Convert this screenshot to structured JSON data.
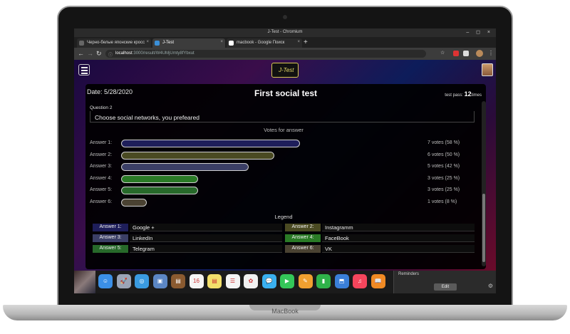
{
  "window": {
    "title": "J-Test - Chromium",
    "controls": "– ◻ ×"
  },
  "tabs": [
    {
      "label": "Черно-белые японские кросс",
      "active": false,
      "favicon_color": "#666666"
    },
    {
      "label": "J-Test",
      "active": true,
      "favicon_color": "#3a8fd8"
    },
    {
      "label": "macbook - Google Поиск",
      "active": false,
      "favicon_color": "#ffffff"
    }
  ],
  "new_tab": "+",
  "address": {
    "host": "localhost",
    "path": ":3000/result/W4UMjUmty8fYbxut",
    "lock": "ⓘ",
    "back": "←",
    "forward": "→",
    "reload": "↻"
  },
  "header": {
    "logo": "J-Test"
  },
  "result": {
    "date": "Date: 5/28/2020",
    "title": "First social test",
    "test_pass_label": "test pass:",
    "test_pass_count": "12",
    "test_pass_unit": "times",
    "question_number": "Question 2",
    "question_text": "Choose social networks, you prefeared",
    "chart_title": "Votes for answer",
    "legend_title": "Legend"
  },
  "chart_data": {
    "type": "bar",
    "orientation": "horizontal",
    "title": "Votes for answer",
    "categories": [
      "Answer 1:",
      "Answer 2:",
      "Answer 3:",
      "Answer 4:",
      "Answer 5:",
      "Answer 6:"
    ],
    "values": [
      7,
      6,
      5,
      3,
      3,
      1
    ],
    "labels": [
      "7 votes (58 %)",
      "6 votes (50 %)",
      "5 votes (42 %)",
      "3 votes (25 %)",
      "3 votes (25 %)",
      "1 votes (8 %)"
    ],
    "colors": [
      "#1e1e5a",
      "#4a4a22",
      "#3b3f66",
      "#2a7a26",
      "#27692a",
      "#4a4232"
    ],
    "max": 12
  },
  "legend": [
    {
      "chip": "Answer 1:",
      "name": "Google +",
      "color": "#1e1e5a"
    },
    {
      "chip": "Answer 2:",
      "name": "Instagramm",
      "color": "#4a4a22"
    },
    {
      "chip": "Answer 3:",
      "name": "LinkedIn",
      "color": "#3b3f66"
    },
    {
      "chip": "Answer 4:",
      "name": "FaceBook",
      "color": "#2a7a26"
    },
    {
      "chip": "Answer 5:",
      "name": "Telegram",
      "color": "#27692a"
    },
    {
      "chip": "Answer 6:",
      "name": "VK",
      "color": "#4a4232"
    }
  ],
  "dock": {
    "icons": [
      {
        "name": "finder-icon",
        "color": "#3b8fe6",
        "glyph": "☺"
      },
      {
        "name": "launchpad-icon",
        "color": "#9aa4b6",
        "glyph": "🚀"
      },
      {
        "name": "safari-icon",
        "color": "#3a9be0",
        "glyph": "◎"
      },
      {
        "name": "preview-icon",
        "color": "#5b86c4",
        "glyph": "▣"
      },
      {
        "name": "notes-brown-icon",
        "color": "#8a5a30",
        "glyph": "▤"
      },
      {
        "name": "calendar-icon",
        "color": "#f4f4f4",
        "glyph": "16"
      },
      {
        "name": "stickies-icon",
        "color": "#f2df6b",
        "glyph": "▤"
      },
      {
        "name": "reminders-icon",
        "color": "#f4f4f4",
        "glyph": "☰"
      },
      {
        "name": "photos-icon",
        "color": "#f0f0f0",
        "glyph": "✿"
      },
      {
        "name": "messages-icon",
        "color": "#3ab0f0",
        "glyph": "💬"
      },
      {
        "name": "facetime-icon",
        "color": "#34c759",
        "glyph": "▶"
      },
      {
        "name": "pages-icon",
        "color": "#f0a030",
        "glyph": "✎"
      },
      {
        "name": "numbers-icon",
        "color": "#2fb34a",
        "glyph": "▮"
      },
      {
        "name": "keynote-icon",
        "color": "#3a7fd8",
        "glyph": "⬒"
      },
      {
        "name": "music-icon",
        "color": "#f5455c",
        "glyph": "♫"
      },
      {
        "name": "books-icon",
        "color": "#f08a24",
        "glyph": "📖"
      }
    ],
    "reminders_title": "Reminders",
    "edit_label": "Edit",
    "gear": "⚙"
  },
  "device_label": "MacBook"
}
